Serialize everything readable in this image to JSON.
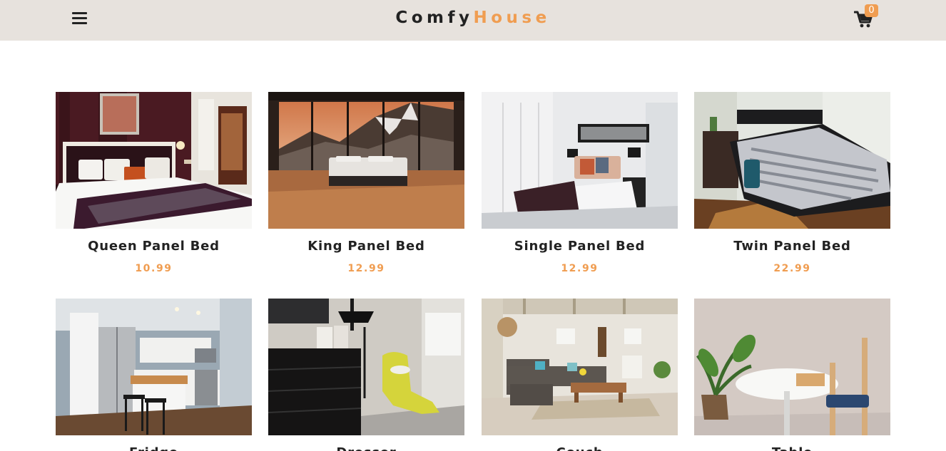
{
  "brand": {
    "part1": "Comfy",
    "part2": "House"
  },
  "cart": {
    "count": "0"
  },
  "colors": {
    "navbar": "#e7e2dd",
    "accent": "#f09d51",
    "text": "#222222"
  },
  "icons": {
    "menu": "bars-icon",
    "cart": "shopping-cart-icon"
  },
  "products": [
    {
      "name": "Queen Panel Bed",
      "price": "10.99",
      "photo": "luxury bedroom with dark headboard"
    },
    {
      "name": "King Panel Bed",
      "price": "12.99",
      "photo": "modern bed facing mountain window"
    },
    {
      "name": "Single Panel Bed",
      "price": "12.99",
      "photo": "white bedroom with artwork"
    },
    {
      "name": "Twin Panel Bed",
      "price": "22.99",
      "photo": "dark bed with striped sheets"
    },
    {
      "name": "Fridge",
      "price": "",
      "photo": "kitchen with stainless fridge"
    },
    {
      "name": "Dresser",
      "price": "",
      "photo": "dresser and yellow chaise"
    },
    {
      "name": "Couch",
      "price": "",
      "photo": "living room with sofa"
    },
    {
      "name": "Table",
      "price": "",
      "photo": "round table with chair and plant"
    }
  ]
}
